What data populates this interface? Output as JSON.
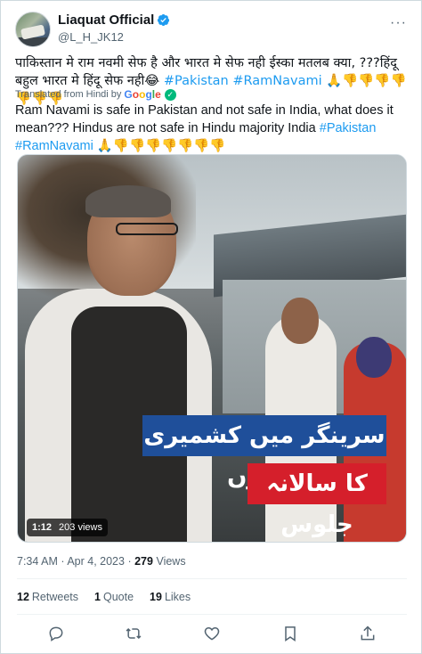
{
  "tweet": {
    "display_name": "Liaquat Official",
    "handle": "@L_H_JK12",
    "more_label": "···",
    "original_text_plain": "पाकिस्तान मे राम नवमी सेफ है और भारत मे सेफ नही ईस्का मतलब क्या, ???हिंदू बहुल भारत मे हिंदू सेफ नही😂 ",
    "original_tags": "#Pakistan #RamNavami",
    "original_emoji": "🙏👎👎👎👎👎👎👎",
    "translated_label": "Translated from Hindi by",
    "translated_provider": "Google",
    "translated_text_plain": "Ram Navami is safe in Pakistan and not safe in India, what does it mean??? Hindus are not safe in Hindu majority India ",
    "translated_tag1": "#Pakistan",
    "translated_tag2": "#RamNavami",
    "translated_emoji": "🙏👎👎👎👎👎👎👎",
    "video": {
      "caption_line1": "سرینگر میں کشمیری پنڈتوں",
      "caption_line2": "کا سالانہ جلوس",
      "duration": "1:12",
      "views": "203 views"
    },
    "time": "7:34 AM",
    "separator": "·",
    "date": "Apr 4, 2023",
    "views_count": "279",
    "views_label": "Views",
    "stats": {
      "retweets_count": "12",
      "retweets_label": "Retweets",
      "quotes_count": "1",
      "quotes_label": "Quote",
      "likes_count": "19",
      "likes_label": "Likes"
    }
  },
  "colors": {
    "link": "#1d9bf0",
    "secondary_text": "#536471",
    "caption_blue": "#1f4f9a",
    "caption_red": "#d51f2b"
  },
  "icons": {
    "verified": "verified-badge-icon",
    "reply": "reply-icon",
    "retweet": "retweet-icon",
    "like": "heart-icon",
    "bookmark": "bookmark-icon",
    "share": "share-icon"
  }
}
